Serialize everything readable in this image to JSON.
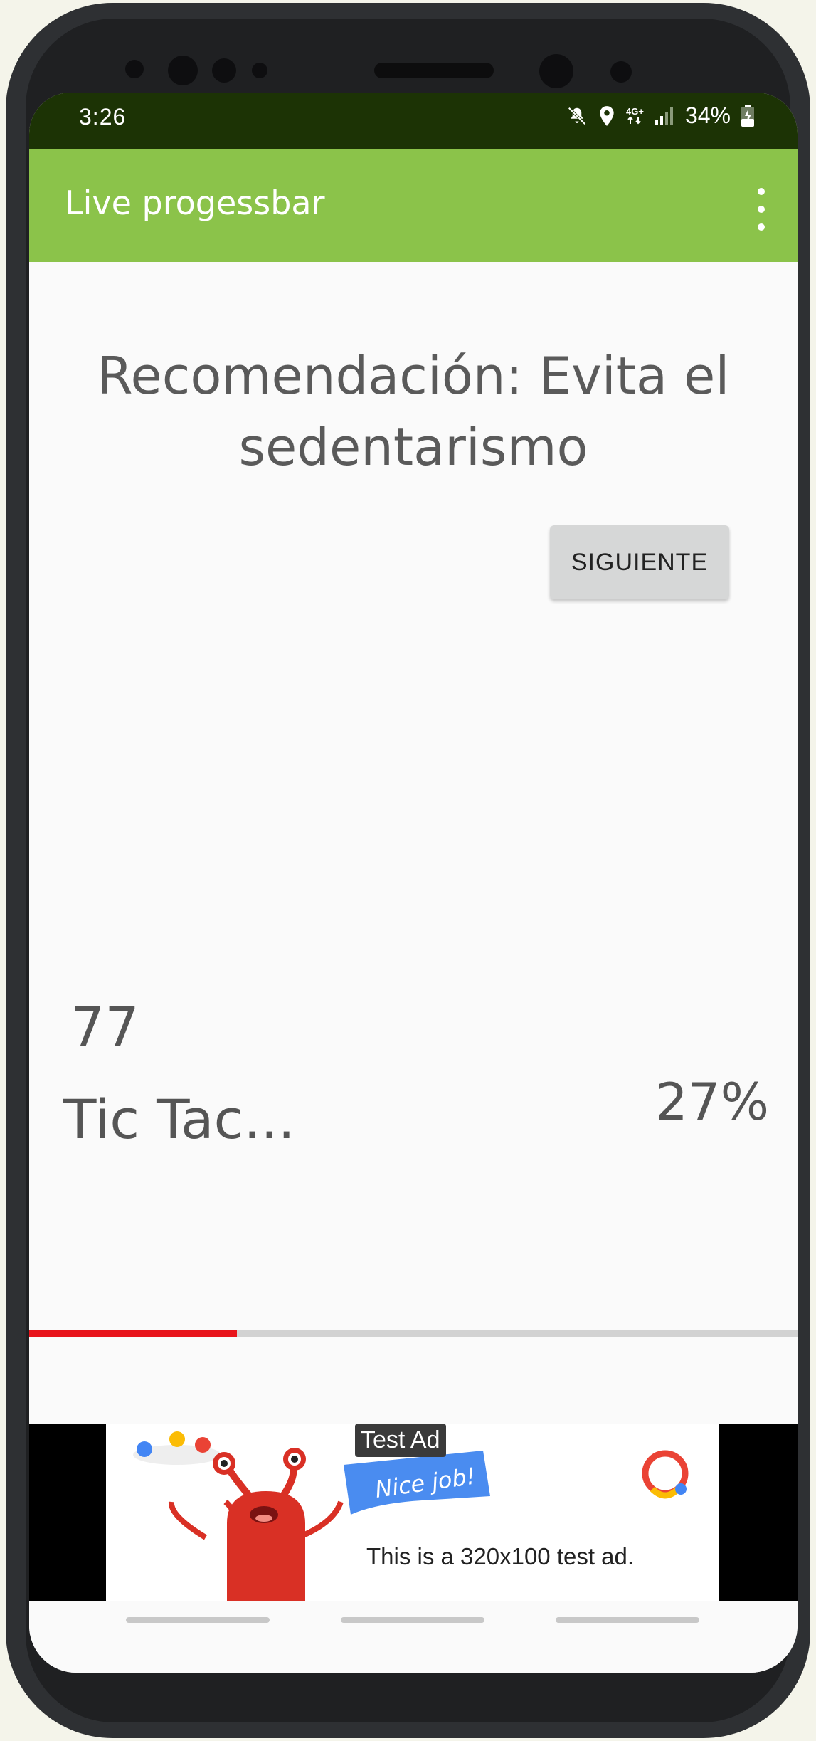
{
  "status_bar": {
    "time": "3:26",
    "network_top": "4G+",
    "battery": "34%"
  },
  "app_bar": {
    "title": "Live progessbar"
  },
  "main": {
    "recommendation": "Recomendación: Evita el sedentarismo",
    "next_button": "SIGUIENTE",
    "counter": "77",
    "tictac": "Tic Tac...",
    "percent": "27%",
    "progress": 0.27
  },
  "ad": {
    "badge": "Test Ad",
    "banner": "Nice job!",
    "text": "This is a 320x100 test ad."
  },
  "colors": {
    "app_bar": "#8bc34a",
    "status_bar": "#1c3305",
    "progress_fill": "#e8141b",
    "progress_track": "#d2d2d2"
  }
}
